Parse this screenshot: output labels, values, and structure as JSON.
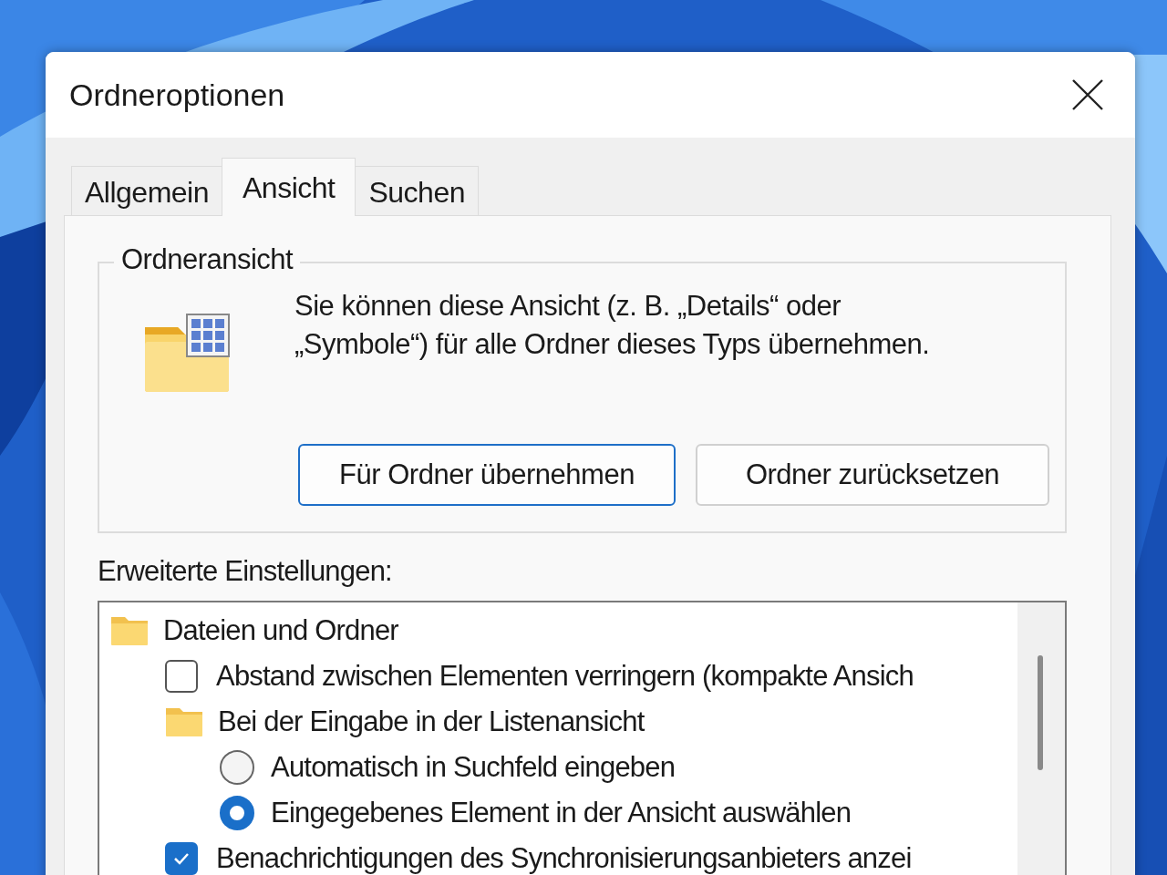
{
  "window": {
    "title": "Ordneroptionen"
  },
  "tabs": [
    {
      "label": "Allgemein",
      "selected": false
    },
    {
      "label": "Ansicht",
      "selected": true
    },
    {
      "label": "Suchen",
      "selected": false
    }
  ],
  "folder_view": {
    "title": "Ordneransicht",
    "description": "Sie können diese Ansicht (z. B. „Details“ oder „Symbole“) für alle Ordner dieses Typs übernehmen.",
    "buttons": [
      {
        "label": "Für Ordner übernehmen",
        "default": true
      },
      {
        "label": "Ordner zurücksetzen",
        "default": false
      }
    ]
  },
  "advanced": {
    "label": "Erweiterte Einstellungen:",
    "tree": [
      {
        "kind": "folder",
        "label": "Dateien und Ordner",
        "children": [
          {
            "kind": "checkbox",
            "label": "Abstand zwischen Elementen verringern (kompakte Ansich",
            "checked": false
          },
          {
            "kind": "folder",
            "label": "Bei der Eingabe in der Listenansicht",
            "children": [
              {
                "kind": "radio",
                "label": "Automatisch in Suchfeld eingeben",
                "selected": false
              },
              {
                "kind": "radio",
                "label": "Eingegebenes Element in der Ansicht auswählen",
                "selected": true
              }
            ]
          },
          {
            "kind": "checkbox",
            "label": "Benachrichtigungen des Synchronisierungsanbieters anzei",
            "checked": true
          }
        ]
      }
    ]
  }
}
